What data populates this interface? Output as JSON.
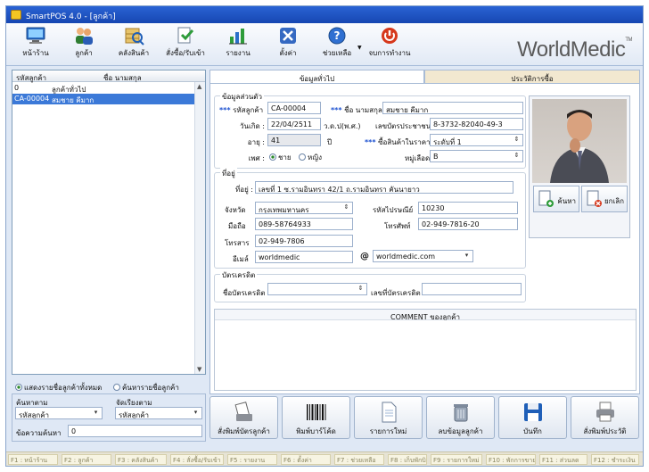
{
  "window": {
    "title": "SmartPOS 4.0 - [ลูกค้า]"
  },
  "toolbar": {
    "items": [
      {
        "label": "หน้าร้าน",
        "icon": "monitor-icon"
      },
      {
        "label": "ลูกค้า",
        "icon": "people-icon"
      },
      {
        "label": "คลังสินค้า",
        "icon": "warehouse-icon"
      },
      {
        "label": "สั่งซื้อ/รับเข้า",
        "icon": "order-icon"
      },
      {
        "label": "รายงาน",
        "icon": "report-chart-icon"
      },
      {
        "label": "ตั้งค่า",
        "icon": "settings-tools-icon"
      },
      {
        "label": "ช่วยเหลือ",
        "icon": "help-icon"
      },
      {
        "label": "จบการทำงาน",
        "icon": "exit-icon"
      }
    ],
    "logo": "WorldMedic",
    "logo_tm": "TM"
  },
  "customer_list": {
    "col_code": "รหัสลูกค้า",
    "col_name": "ชื่อ นามสกุล",
    "rows": [
      {
        "code": "0",
        "name": "ลูกค้าทั่วไป"
      },
      {
        "code": "CA-00004",
        "name": "สมชาย คีมาก"
      }
    ],
    "selected_index": 1,
    "radio_all": "แสดงรายชื่อลูกค้าทั้งหมด",
    "radio_search": "ค้นหารายชื่อลูกค้า",
    "search_by_label": "ค้นหาตาม",
    "search_by_value": "รหัสลูกค้า",
    "sort_by_label": "จัดเรียงตาม",
    "sort_by_value": "รหัสลูกค้า",
    "keyword_label": "ข้อความค้นหา",
    "keyword_value": "0"
  },
  "tabs": {
    "general": "ข้อมูลทั่วไป",
    "history": "ประวัติการซื้อ"
  },
  "personal": {
    "group_title": "ข้อมูลส่วนตัว",
    "required_mark": "***",
    "code_label": "รหัสลูกค้า",
    "code_value": "CA-00004",
    "name_label": "ชื่อ นามสกุล",
    "name_value": "สมชาย คีมาก",
    "birth_label": "วันเกิด :",
    "birth_value": "22/04/2511",
    "birth_era": "ว.ด.ป(พ.ศ.)",
    "idcard_label": "เลขบัตรประชาชน",
    "idcard_value": "8-3732-82040-49-3",
    "age_label": "อายุ :",
    "age_value": "41",
    "age_unit": "ปี",
    "price_level_label": "ซื้อสินค้าในราคา",
    "price_level_value": "ระดับที่ 1",
    "gender_label": "เพศ :",
    "gender_male": "ชาย",
    "gender_female": "หญิง",
    "blood_label": "หมู่เลือด",
    "blood_value": "B"
  },
  "address": {
    "group_title": "ที่อยู่",
    "addr_label": "ที่อยู่ :",
    "addr_value": "เลขที่ 1 ซ.รามอินทรา 42/1 ถ.รามอินทรา คันนายาว",
    "province_label": "จังหวัด",
    "province_value": "กรุงเทพมหานคร",
    "zip_label": "รหัสไปรษณีย์",
    "zip_value": "10230",
    "mobile_label": "มือถือ",
    "mobile_value": "089-58764933",
    "phone_label": "โทรศัพท์",
    "phone_value": "02-949-7816-20",
    "fax_label": "โทรสาร",
    "fax_value": "02-949-7806",
    "email_label": "อีเมล์",
    "email_user": "worldmedic",
    "email_at": "@",
    "email_domain": "worldmedic.com"
  },
  "credit": {
    "group_title": "บัตรเครดิต",
    "card_name_label": "ชื่อบัตรเครดิต",
    "card_name_value": "",
    "card_no_label": "เลขที่บัตรเครดิต",
    "card_no_value": ""
  },
  "photo": {
    "search_label": "ค้นหา",
    "cancel_label": "ยกเลิก"
  },
  "comment": {
    "header": "COMMENT ของลูกค้า",
    "text": ""
  },
  "actions": [
    {
      "label": "สั่งพิมพ์บัตรลูกค้า",
      "icon": "print-card-icon"
    },
    {
      "label": "พิมพ์บาร์โค้ด",
      "icon": "barcode-icon"
    },
    {
      "label": "รายการใหม่",
      "icon": "new-document-icon"
    },
    {
      "label": "ลบข้อมูลลูกค้า",
      "icon": "delete-bin-icon"
    },
    {
      "label": "บันทึก",
      "icon": "save-disk-icon"
    },
    {
      "label": "สั่งพิมพ์ประวัติ",
      "icon": "printer-icon"
    }
  ],
  "fkeys": [
    "F1 : หน้าร้าน",
    "F2 : ลูกค้า",
    "F3 : คลังสินค้า",
    "F4 : สั่งซื้อ/รับเข้า",
    "F5 : รายงาน",
    "F6 : ตั้งค่า",
    "F7 : ช่วยเหลือ",
    "F8 : เก็บพักบิล",
    "F9 : รายการใหม่",
    "F10 : พักการขาย",
    "F11 : ส่วนลด",
    "F12 : ชำระเงิน"
  ]
}
